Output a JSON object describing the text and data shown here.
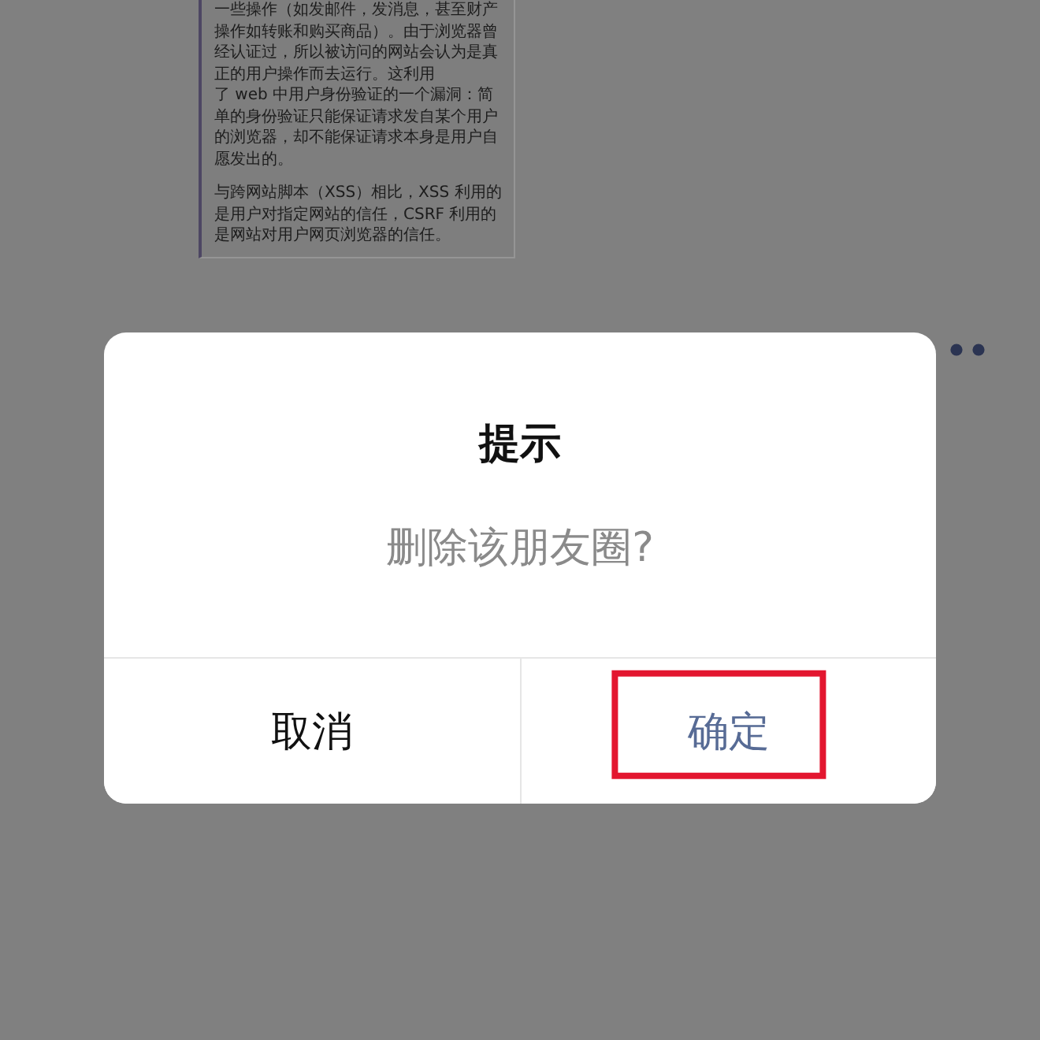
{
  "document": {
    "paragraphs": [
      {
        "lines": [
          "一些操作（如发邮件，发消息，甚至财产",
          "操作如转账和购买商品）。由于浏览器曾",
          "经认证过，所以被访问的网站会认为是真",
          "正的用户操作而去运行。这利用",
          "了 web 中用户身份验证的一个漏洞：简",
          "单的身份验证只能保证请求发自某个用户",
          "的浏览器，却不能保证请求本身是用户自",
          "愿发出的。"
        ]
      },
      {
        "lines": [
          "与跨网站脚本（XSS）相比，XSS 利用的",
          "是用户对指定网站的信任，CSRF 利用的",
          "是网站对用户网页浏览器的信任。"
        ]
      }
    ]
  },
  "dialog": {
    "title": "提示",
    "message": "删除该朋友圈?",
    "buttons": [
      {
        "label": "取消",
        "kind": "cancel",
        "highlighted": false
      },
      {
        "label": "确定",
        "kind": "confirm",
        "highlighted": true
      }
    ]
  }
}
